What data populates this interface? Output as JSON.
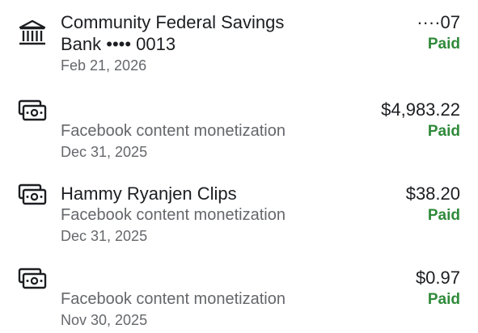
{
  "payouts": [
    {
      "icon": "bank-icon",
      "title": "Community Federal Savings Bank •••• 0013",
      "subtitle": "",
      "date": "Feb 21, 2026",
      "amount": "····07",
      "status": "Paid"
    },
    {
      "icon": "cash-icon",
      "title": "",
      "subtitle": "Facebook content monetization",
      "date": "Dec 31, 2025",
      "amount": "$4,983.22",
      "status": "Paid"
    },
    {
      "icon": "cash-icon",
      "title": "Hammy Ryanjen Clips",
      "subtitle": "Facebook content monetization",
      "date": "Dec 31, 2025",
      "amount": "$38.20",
      "status": "Paid"
    },
    {
      "icon": "cash-icon",
      "title": "",
      "subtitle": "Facebook content monetization",
      "date": "Nov 30, 2025",
      "amount": "$0.97",
      "status": "Paid"
    }
  ],
  "colors": {
    "paid": "#2f8a3a",
    "primary_text": "#1c1e21",
    "secondary_text": "#65676b"
  }
}
